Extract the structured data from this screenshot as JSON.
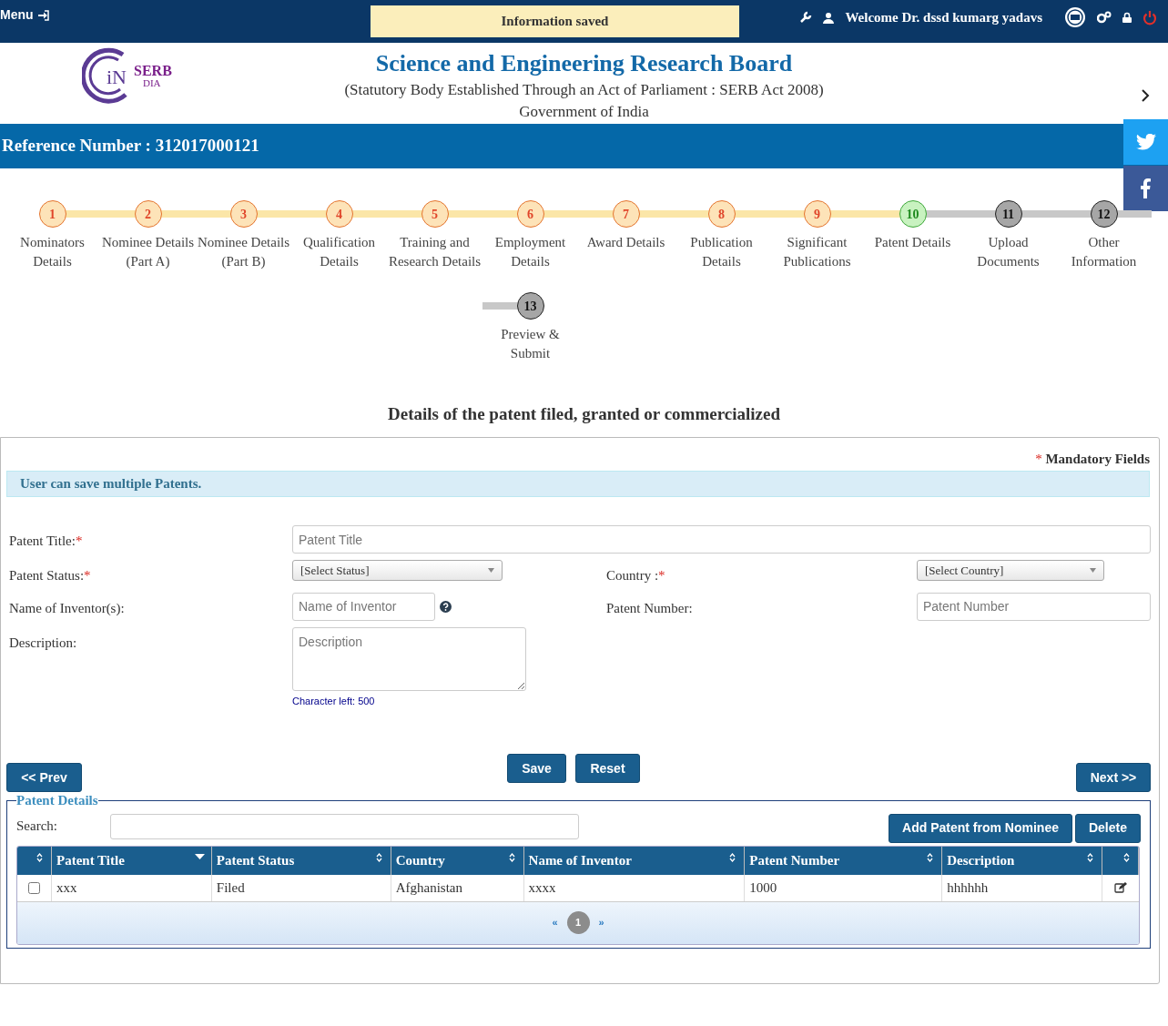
{
  "top_bar": {
    "menu_label": "Menu",
    "notification": "Information saved",
    "welcome": "Welcome Dr. dssd kumarg yadavs"
  },
  "header": {
    "logo_text": "SERB",
    "logo_sub": "DIA",
    "logo_letters": "iN",
    "title": "Science and Engineering Research Board",
    "subtitle": "(Statutory Body Established Through an Act of Parliament : SERB Act 2008)",
    "government": "Government of India"
  },
  "reference": "Reference Number : 312017000121",
  "steps": [
    {
      "number": "1",
      "label": "Nominators Details",
      "kind": "done"
    },
    {
      "number": "2",
      "label": "Nominee Details (Part A)",
      "kind": "done"
    },
    {
      "number": "3",
      "label": "Nominee Details (Part B)",
      "kind": "done"
    },
    {
      "number": "4",
      "label": "Qualification Details",
      "kind": "done"
    },
    {
      "number": "5",
      "label": "Training and Research Details",
      "kind": "done"
    },
    {
      "number": "6",
      "label": "Employment Details",
      "kind": "done"
    },
    {
      "number": "7",
      "label": "Award Details",
      "kind": "done"
    },
    {
      "number": "8",
      "label": "Publication Details",
      "kind": "done"
    },
    {
      "number": "9",
      "label": "Significant Publications",
      "kind": "done"
    },
    {
      "number": "10",
      "label": "Patent Details",
      "kind": "current"
    },
    {
      "number": "11",
      "label": "Upload Documents",
      "kind": "pending"
    },
    {
      "number": "12",
      "label": "Other Information",
      "kind": "pending"
    },
    {
      "number": "13",
      "label": "Preview & Submit",
      "kind": "pending"
    }
  ],
  "section_title": "Details of the patent filed, granted or commercialized",
  "mandatory": {
    "marker": "*",
    "text": "Mandatory Fields"
  },
  "info_message": "User can save multiple Patents.",
  "form_rows": [
    [
      {
        "label": "Patent Title:",
        "required": true,
        "kind": "text",
        "placeholder": "Patent Title",
        "wide": true
      }
    ],
    [
      {
        "label": "Patent Status:",
        "required": true,
        "kind": "select",
        "value": "[Select Status]"
      },
      {
        "label": "Country :",
        "required": true,
        "kind": "select",
        "value": "[Select Country]"
      }
    ],
    [
      {
        "label": "Name of Inventor(s):",
        "required": false,
        "kind": "text",
        "placeholder": "Name of Inventor",
        "help": true
      },
      {
        "label": "Patent Number:",
        "required": false,
        "kind": "text",
        "placeholder": "Patent Number"
      }
    ],
    [
      {
        "label": "Description:",
        "required": false,
        "kind": "textarea",
        "placeholder": "Description",
        "counter": "Character left: 500"
      }
    ]
  ],
  "buttons": {
    "prev": "<< Prev",
    "save": "Save",
    "reset": "Reset",
    "next": "Next >>"
  },
  "patent_details": {
    "legend": "Patent Details",
    "search_label": "Search:",
    "actions": [
      "Add Patent from Nominee",
      "Delete"
    ],
    "checkbox_column": {
      "kind": "sortable"
    },
    "columns": [
      {
        "label": "Patent Title",
        "kind": "sorted-desc"
      },
      {
        "label": "Patent Status",
        "kind": "sortable"
      },
      {
        "label": "Country",
        "kind": "sortable"
      },
      {
        "label": "Name of Inventor",
        "kind": "sortable"
      },
      {
        "label": "Patent Number",
        "kind": "sortable"
      },
      {
        "label": "Description",
        "kind": "sortable"
      }
    ],
    "edit_column": {
      "kind": "sortable"
    },
    "rows": [
      {
        "selected": false,
        "cells": [
          "xxx",
          "Filed",
          "Afghanistan",
          "xxxx",
          "1000",
          "hhhhhh"
        ]
      }
    ],
    "pagination": {
      "first": "«",
      "last": "»",
      "pages": [
        {
          "label": "1",
          "selected": true
        }
      ]
    }
  }
}
